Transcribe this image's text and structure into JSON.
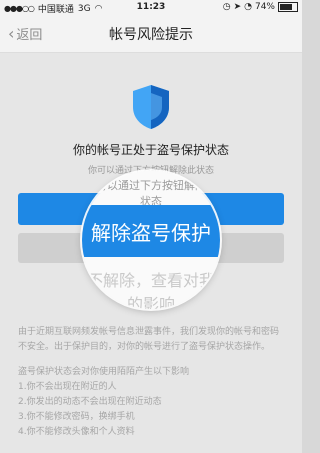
{
  "status_bar": {
    "carrier": "中国联通",
    "network": "3G",
    "time": "11:23",
    "battery_percent": "74%",
    "battery_level": 0.74
  },
  "nav": {
    "back_label": "返回",
    "title": "帐号风险提示"
  },
  "main": {
    "status_title": "你的帐号正处于盗号保护状态",
    "status_sub": "你可以通过下方按钮解除此状态",
    "primary_button": "解除盗号保护",
    "secondary_button": "不解除，查看对我的影响",
    "magnified_under_text": "不解除，查看对我的影响"
  },
  "info": {
    "paragraph": "由于近期互联网频发帐号信息泄露事件，我们发现你的帐号和密码不安全。出于保护目的，对你的帐号进行了盗号保护状态操作。",
    "list_title": "盗号保护状态会对你使用陌陌产生以下影响",
    "items": [
      "1.你不会出现在附近的人",
      "2.你发出的动态不会出现在附近动态",
      "3.你不能修改密码，换绑手机",
      "4.你不能修改头像和个人资料"
    ]
  },
  "colors": {
    "accent": "#1e88e5",
    "shield_dark": "#1565c0",
    "shield_light": "#42a5f5"
  }
}
